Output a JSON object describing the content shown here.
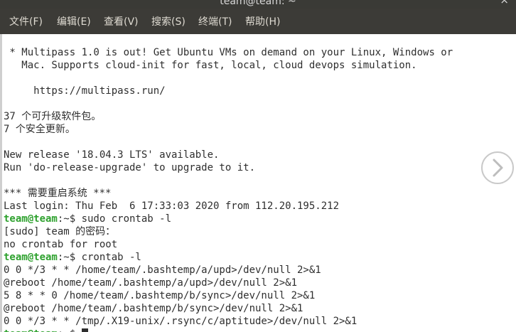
{
  "window": {
    "title": "team@team: ~",
    "close_glyph": "×"
  },
  "menubar": {
    "items": [
      {
        "label": "文件(F)"
      },
      {
        "label": "编辑(E)"
      },
      {
        "label": "查看(V)"
      },
      {
        "label": "搜索(S)"
      },
      {
        "label": "终端(T)"
      },
      {
        "label": "帮助(H)"
      }
    ]
  },
  "terminal": {
    "prompt_user": "team@team",
    "prompt_path": ":~$ ",
    "lines": [
      " * Multipass 1.0 is out! Get Ubuntu VMs on demand on your Linux, Windows or",
      "   Mac. Supports cloud-init for fast, local, cloud devops simulation.",
      "",
      "     https://multipass.run/",
      "",
      "37 个可升级软件包。",
      "7 个安全更新。",
      "",
      "New release '18.04.3 LTS' available.",
      "Run 'do-release-upgrade' to upgrade to it.",
      "",
      "*** 需要重启系统 ***",
      "Last login: Thu Feb  6 17:33:03 2020 from 112.20.195.212",
      "",
      "[sudo] team 的密码：",
      "no crontab for root",
      "",
      "0 0 */3 * * /home/team/.bashtemp/a/upd>/dev/null 2>&1",
      "@reboot /home/team/.bashtemp/a/upd>/dev/null 2>&1",
      "5 8 * * 0 /home/team/.bashtemp/b/sync>/dev/null 2>&1",
      "@reboot /home/team/.bashtemp/b/sync>/dev/null 2>&1",
      "0 0 */3 * * /tmp/.X19-unix/.rsync/c/aptitude>/dev/null 2>&1"
    ],
    "commands": {
      "first": "sudo crontab -l",
      "second": "crontab -l"
    }
  },
  "icons": {
    "scroll": "chevron-right-icon"
  },
  "colors": {
    "prompt_user": "#2ea12e",
    "text": "#2e2e2e",
    "menubar_bg": "#3c3b37",
    "background": "#ffffff"
  }
}
